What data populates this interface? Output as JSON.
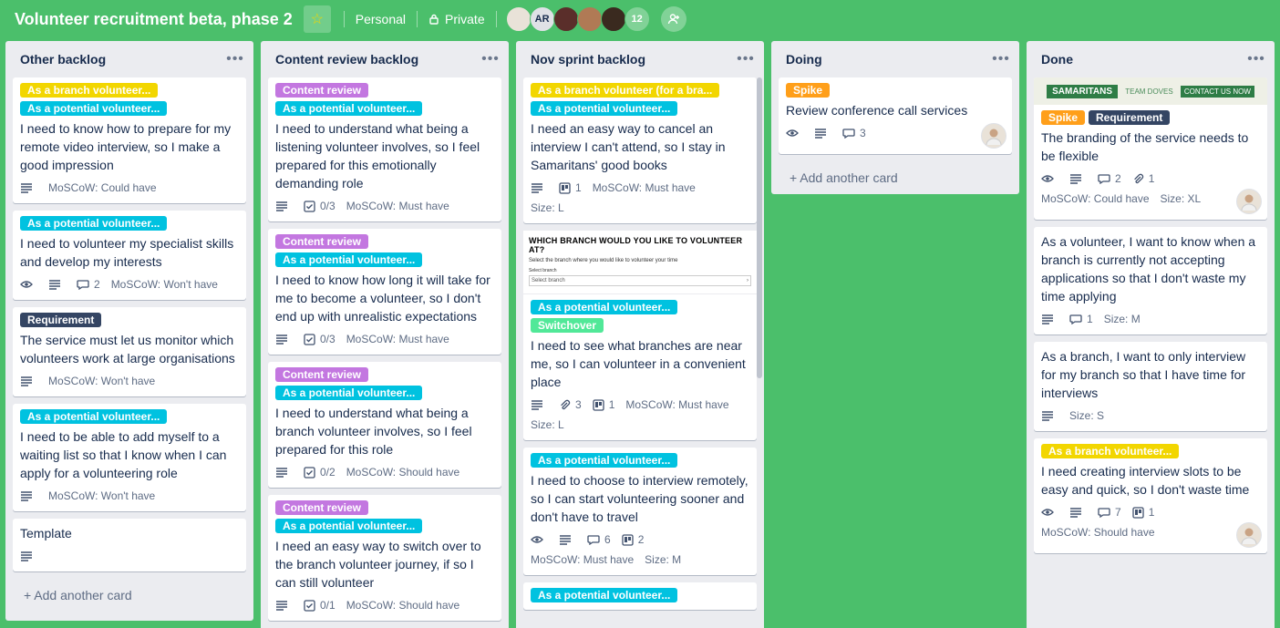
{
  "board": {
    "title": "Volunteer recruitment beta, phase 2",
    "visibility_team": "Personal",
    "visibility_privacy": "Private",
    "members": [
      {
        "initials": ""
      },
      {
        "initials": "AR"
      },
      {
        "initials": ""
      },
      {
        "initials": ""
      },
      {
        "initials": ""
      }
    ],
    "member_overflow": "12"
  },
  "lists": [
    {
      "title": "Other backlog",
      "add_card": "+ Add another card",
      "cards": [
        {
          "labels": [
            {
              "text": "As a branch volunteer...",
              "color": "yellow"
            },
            {
              "text": "As a potential volunteer...",
              "color": "cyan"
            }
          ],
          "title": "I need to know how to prepare for my remote video interview, so I make a good impression",
          "badges": {
            "description": true,
            "moscow": "MoSCoW: Could have"
          }
        },
        {
          "labels": [
            {
              "text": "As a potential volunteer...",
              "color": "cyan"
            }
          ],
          "title": "I need to volunteer my specialist skills and develop my interests",
          "badges": {
            "watch": true,
            "description": true,
            "comments": "2",
            "moscow": "MoSCoW: Won't have"
          }
        },
        {
          "labels": [
            {
              "text": "Requirement",
              "color": "dark"
            }
          ],
          "title": "The service must let us monitor which volunteers work at large organisations",
          "badges": {
            "description": true,
            "moscow": "MoSCoW: Won't have"
          }
        },
        {
          "labels": [
            {
              "text": "As a potential volunteer...",
              "color": "cyan"
            }
          ],
          "title": "I need to be able to add myself to a waiting list so that I know when I can apply for a volunteering role",
          "badges": {
            "description": true,
            "moscow": "MoSCoW: Won't have"
          }
        },
        {
          "labels": [],
          "title": "Template",
          "badges": {
            "description": true
          }
        }
      ]
    },
    {
      "title": "Content review backlog",
      "cards": [
        {
          "labels": [
            {
              "text": "Content review",
              "color": "purple"
            },
            {
              "text": "As a potential volunteer...",
              "color": "cyan"
            }
          ],
          "title": "I need to understand what being a listening volunteer involves, so I feel prepared for this emotionally demanding role",
          "badges": {
            "description": true,
            "checklist": "0/3",
            "moscow": "MoSCoW: Must have"
          }
        },
        {
          "labels": [
            {
              "text": "Content review",
              "color": "purple"
            },
            {
              "text": "As a potential volunteer...",
              "color": "cyan"
            }
          ],
          "title": "I need to know how long it will take for me to become a volunteer, so I don't end up with unrealistic expectations",
          "badges": {
            "description": true,
            "checklist": "0/3",
            "moscow": "MoSCoW: Must have"
          }
        },
        {
          "labels": [
            {
              "text": "Content review",
              "color": "purple"
            },
            {
              "text": "As a potential volunteer...",
              "color": "cyan"
            }
          ],
          "title": "I need to understand what being a branch volunteer involves, so I feel prepared for this role",
          "badges": {
            "description": true,
            "checklist": "0/2",
            "moscow": "MoSCoW: Should have"
          }
        },
        {
          "labels": [
            {
              "text": "Content review",
              "color": "purple"
            },
            {
              "text": "As a potential volunteer...",
              "color": "cyan"
            }
          ],
          "title": "I need an easy way to switch over to the branch volunteer journey, if so I can still volunteer",
          "badges": {
            "description": true,
            "checklist": "0/1",
            "moscow": "MoSCoW: Should have"
          }
        }
      ]
    },
    {
      "title": "Nov sprint backlog",
      "cards": [
        {
          "labels": [
            {
              "text": "As a branch volunteer (for a bra...",
              "color": "yellow"
            },
            {
              "text": "As a potential volunteer...",
              "color": "cyan"
            }
          ],
          "title": "I need an easy way to cancel an interview I can't attend, so I stay in Samaritans' good books",
          "badges": {
            "description": true,
            "trello": "1",
            "moscow": "MoSCoW: Must have",
            "size": "Size: L"
          }
        },
        {
          "form_preview": {
            "title": "WHICH BRANCH WOULD YOU LIKE TO VOLUNTEER AT?",
            "subtitle": "Select the branch where you would like to volunteer your time",
            "field_label": "Select branch",
            "placeholder": "Select branch"
          },
          "labels": [
            {
              "text": "As a potential volunteer...",
              "color": "cyan"
            },
            {
              "text": "Switchover",
              "color": "green"
            }
          ],
          "title": "I need to see what branches are near me, so I can volunteer in a convenient place",
          "badges": {
            "description": true,
            "attachments": "3",
            "trello": "1",
            "moscow": "MoSCoW: Must have",
            "size": "Size: L"
          }
        },
        {
          "labels": [
            {
              "text": "As a potential volunteer...",
              "color": "cyan"
            }
          ],
          "title": "I need to choose to interview remotely, so I can start volunteering sooner and don't have to travel",
          "badges": {
            "watch": true,
            "description": true,
            "comments": "6",
            "trello": "2",
            "moscow": "MoSCoW: Must have",
            "size": "Size: M"
          }
        },
        {
          "labels": [
            {
              "text": "As a potential volunteer...",
              "color": "cyan"
            }
          ],
          "title": "",
          "badges": {}
        }
      ]
    },
    {
      "title": "Doing",
      "add_card": "+ Add another card",
      "cards": [
        {
          "labels": [
            {
              "text": "Spike",
              "color": "orange"
            }
          ],
          "title": "Review conference call services",
          "badges": {
            "watch": true,
            "description": true,
            "comments": "3"
          },
          "member": true
        }
      ]
    },
    {
      "title": "Done",
      "cards": [
        {
          "cover": {
            "left": "SAMARITANS",
            "middle": "TEAM DOVES",
            "right": "CONTACT US NOW"
          },
          "labels": [
            {
              "text": "Spike",
              "color": "orange"
            },
            {
              "text": "Requirement",
              "color": "dark"
            }
          ],
          "title": "The branding of the service needs to be flexible",
          "badges": {
            "watch": true,
            "description": true,
            "comments": "2",
            "attachments": "1",
            "moscow": "MoSCoW: Could have",
            "size": "Size: XL"
          },
          "member": true
        },
        {
          "labels": [],
          "title": "As a volunteer, I want to know when a branch is currently not accepting applications so that I don't waste my time applying",
          "badges": {
            "description": true,
            "comments": "1",
            "size": "Size: M"
          }
        },
        {
          "labels": [],
          "title": "As a branch, I want to only interview for my branch so that I have time for interviews",
          "badges": {
            "description": true,
            "size": "Size: S"
          }
        },
        {
          "labels": [
            {
              "text": "As a branch volunteer...",
              "color": "yellow"
            }
          ],
          "title": "I need creating interview slots to be easy and quick, so I don't waste time",
          "badges": {
            "watch": true,
            "description": true,
            "comments": "7",
            "trello": "1",
            "moscow": "MoSCoW: Should have"
          },
          "member": true
        }
      ]
    }
  ],
  "colors": {
    "board_bg": "#4bbf6b",
    "list_bg": "#ebecf0",
    "yellow": "#f2d600",
    "cyan": "#00c2e0",
    "purple": "#c377e0",
    "dark": "#344563",
    "orange": "#ff9f1a",
    "green": "#51e898"
  }
}
